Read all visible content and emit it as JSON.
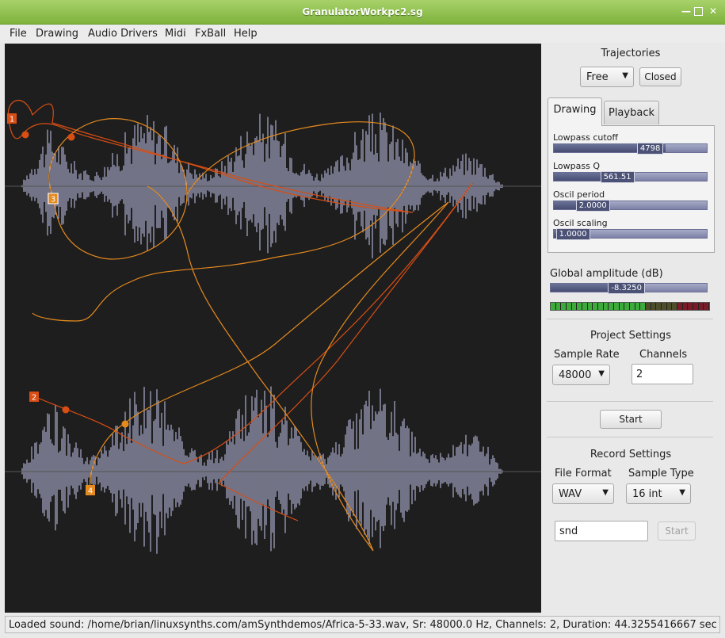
{
  "window": {
    "title": "GranulatorWorkpc2.sg",
    "controls": [
      "minimize",
      "maximize",
      "close"
    ]
  },
  "menu": [
    "File",
    "Drawing",
    "Audio Drivers",
    "Midi",
    "FxBall",
    "Help"
  ],
  "trajectories": {
    "title": "Trajectories",
    "mode_value": "Free",
    "closed_label": "Closed",
    "markers": [
      "1",
      "2",
      "3",
      "4"
    ]
  },
  "tabs": [
    "Drawing",
    "Playback"
  ],
  "sliders": [
    {
      "label": "Lowpass cutoff",
      "value": "4798"
    },
    {
      "label": "Lowpass Q",
      "value": "561.51"
    },
    {
      "label": "Oscil period",
      "value": "2.0000"
    },
    {
      "label": "Oscil scaling",
      "value": "1.0000"
    }
  ],
  "slider_levels": [
    0.73,
    0.49,
    0.33,
    0.2
  ],
  "global_amplitude": {
    "label": "Global amplitude (dB)",
    "value": "-8.3250",
    "level": 0.55
  },
  "project": {
    "title": "Project Settings",
    "sample_rate_label": "Sample Rate",
    "sample_rate_value": "48000",
    "channels_label": "Channels",
    "channels_value": "2",
    "start_label": "Start"
  },
  "record": {
    "title": "Record Settings",
    "file_format_label": "File Format",
    "file_format_value": "WAV",
    "sample_type_label": "Sample Type",
    "sample_type_value": "16 int",
    "filename_value": "snd",
    "start_label": "Start"
  },
  "status": "Loaded sound: /home/brian/linuxsynths.com/amSynthdemos/Africa-5-33.wav,    Sr: 48000.0 Hz,    Channels: 2,    Duration: 44.3255416667 sec",
  "colors": {
    "waveform": "#b7b9da",
    "trajectory_1": "#d84e14",
    "trajectory_2": "#e58a1e",
    "canvas_bg": "#1e1e1e",
    "meter_green": "#3cab3a",
    "meter_red": "#7b1b2a"
  }
}
